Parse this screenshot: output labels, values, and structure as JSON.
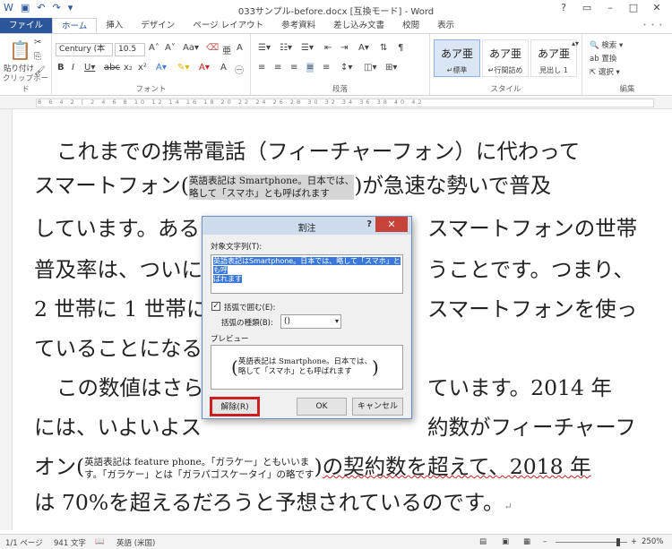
{
  "window": {
    "title": "033サンプル-before.docx [互換モード] - Word",
    "user": "・・・"
  },
  "tabs": [
    "ファイル",
    "ホーム",
    "挿入",
    "デザイン",
    "ページ レイアウト",
    "参考資料",
    "差し込み文書",
    "校閲",
    "表示"
  ],
  "ribbon": {
    "clipboard": {
      "paste": "貼り付け",
      "label": "クリップボード"
    },
    "font": {
      "name": "Century (本",
      "size": "10.5",
      "label": "フォント"
    },
    "paragraph": {
      "label": "段落"
    },
    "styles": {
      "label": "スタイル",
      "items": [
        {
          "sample": "あア亜",
          "name": "↵標準"
        },
        {
          "sample": "あア亜",
          "name": "↵行間詰め"
        },
        {
          "sample": "あア亜",
          "name": "見出し 1"
        }
      ]
    },
    "editing": {
      "find": "検索",
      "replace": "置換",
      "select": "選択",
      "label": "編集"
    }
  },
  "ruler": {
    "marks": "8 6 4 2 | 2 4 6 8 10 12 14 16 18 20 22 24 26 28 30 32 34 36 38 40 42"
  },
  "document": {
    "l1": "これまでの携帯電話（フィーチャーフォン）に代わって",
    "l2a": "スマートフォン",
    "wn1a": "英語表記は Smartphone。日本では、",
    "wn1b": "略して「スマホ」とも呼ばれます",
    "l2b": "が急速な勢いで普及",
    "l3a": "しています。ある",
    "l3b": "スマートフォンの世帯",
    "l4a": "普及率は、ついに",
    "l4b": "うことです。つまり、",
    "l5a": "2 世帯に 1 世帯に",
    "l5b": "スマートフォンを使っ",
    "l6": "ていることになる",
    "l7a": "この数値はさら",
    "l7b": "ています。2014 年",
    "l8a": "には、いよいよス",
    "l8b": "約数がフィーチャーフ",
    "l9a": "オン",
    "wn2a": "英語表記は feature phone。「ガラケー」ともいいま",
    "wn2b": "す。「ガラケー」とは「ガラパゴスケータイ」の略です",
    "l9b": "の契約数を超えて、2018 年",
    "l10": "は 70%を超えるだろうと予想されているのです。",
    "pilcrow": "↵"
  },
  "dialog": {
    "title": "割注",
    "help": "?",
    "close": "✕",
    "target_label": "対象文字列(T):",
    "target_text_l1": "英語表記はSmartphone。日本では、略して「スマホ」とも呼",
    "target_text_l2": "ばれます",
    "bracket_check": "括弧で囲む(E):",
    "bracket_type_label": "括弧の種類(B):",
    "bracket_type_value": "()",
    "preview_label": "プレビュー",
    "preview_l1": "英語表記は Smartphone。日本では、",
    "preview_l2": "略して「スマホ」とも呼ばれます",
    "remove_btn": "解除(R)",
    "ok_btn": "OK",
    "cancel_btn": "キャンセル"
  },
  "status": {
    "page": "1/1 ページ",
    "words": "941 文字",
    "lang": "英語 (米国)",
    "zoom": "250%"
  }
}
